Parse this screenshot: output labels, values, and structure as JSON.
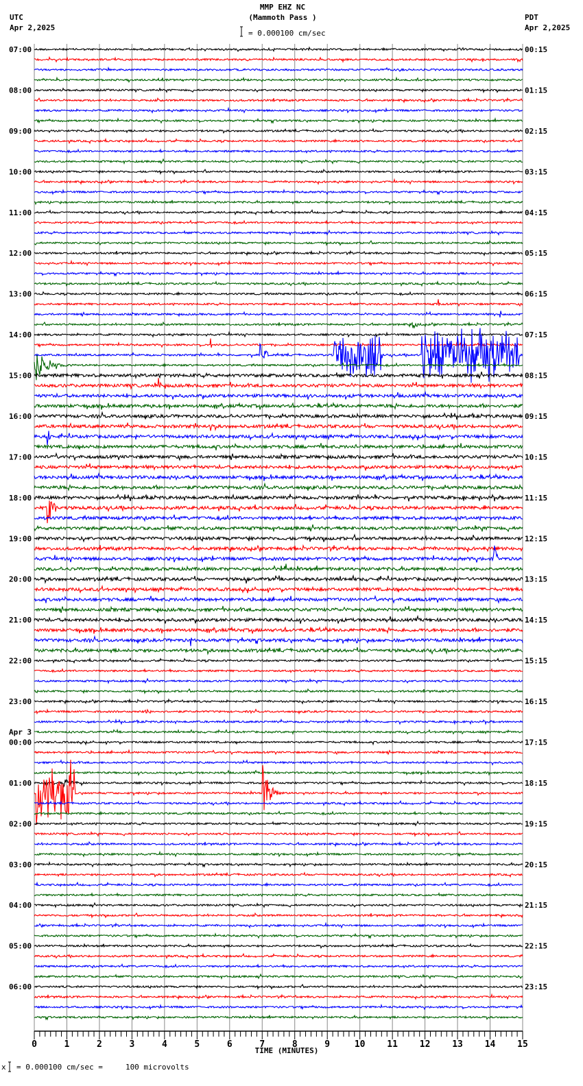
{
  "header": {
    "title": "MMP EHZ NC",
    "subtitle": "(Mammoth Pass )",
    "scale_text": "= 0.000100 cm/sec",
    "left_tz": "UTC",
    "left_date": "Apr 2,2025",
    "right_tz": "PDT",
    "right_date": "Apr 2,2025"
  },
  "footer": {
    "scale_prefix": "x",
    "scale_text": "= 0.000100 cm/sec =     100 microvolts"
  },
  "chart_data": {
    "type": "line",
    "title": "MMP EHZ NC (Mammoth Pass )",
    "xlabel": "TIME (MINUTES)",
    "xlim": [
      0,
      15
    ],
    "x_ticks": [
      "0",
      "1",
      "2",
      "3",
      "4",
      "5",
      "6",
      "7",
      "8",
      "9",
      "10",
      "11",
      "12",
      "13",
      "14",
      "15"
    ],
    "traces_per_hour": 4,
    "trace_count": 96,
    "trace_colors": [
      "#000000",
      "#ff0000",
      "#0000ff",
      "#006400"
    ],
    "grid": "vertical, every minute",
    "left_labels": [
      {
        "trace": 0,
        "text": "07:00"
      },
      {
        "trace": 4,
        "text": "08:00"
      },
      {
        "trace": 8,
        "text": "09:00"
      },
      {
        "trace": 12,
        "text": "10:00"
      },
      {
        "trace": 16,
        "text": "11:00"
      },
      {
        "trace": 20,
        "text": "12:00"
      },
      {
        "trace": 24,
        "text": "13:00"
      },
      {
        "trace": 28,
        "text": "14:00"
      },
      {
        "trace": 32,
        "text": "15:00"
      },
      {
        "trace": 36,
        "text": "16:00"
      },
      {
        "trace": 40,
        "text": "17:00"
      },
      {
        "trace": 44,
        "text": "18:00"
      },
      {
        "trace": 48,
        "text": "19:00"
      },
      {
        "trace": 52,
        "text": "20:00"
      },
      {
        "trace": 56,
        "text": "21:00"
      },
      {
        "trace": 60,
        "text": "22:00"
      },
      {
        "trace": 64,
        "text": "23:00"
      },
      {
        "trace": 68,
        "text": "00:00",
        "date": "Apr 3"
      },
      {
        "trace": 72,
        "text": "01:00"
      },
      {
        "trace": 76,
        "text": "02:00"
      },
      {
        "trace": 80,
        "text": "03:00"
      },
      {
        "trace": 84,
        "text": "04:00"
      },
      {
        "trace": 88,
        "text": "05:00"
      },
      {
        "trace": 92,
        "text": "06:00"
      }
    ],
    "right_labels": [
      "00:15",
      "01:15",
      "02:15",
      "03:15",
      "04:15",
      "05:15",
      "06:15",
      "07:15",
      "08:15",
      "09:15",
      "10:15",
      "11:15",
      "12:15",
      "13:15",
      "14:15",
      "15:15",
      "16:15",
      "17:15",
      "18:15",
      "19:15",
      "20:15",
      "21:15",
      "22:15",
      "23:15"
    ],
    "noisy_trace_range": [
      32,
      59
    ],
    "events": [
      {
        "trace": 25,
        "minute": 12.4,
        "amp": 0.6,
        "dur": 0.1
      },
      {
        "trace": 26,
        "minute": 14.3,
        "amp": 0.8,
        "dur": 0.1
      },
      {
        "trace": 27,
        "minute": 11.6,
        "amp": 0.8,
        "dur": 0.3
      },
      {
        "trace": 29,
        "minute": 5.4,
        "amp": 1.0,
        "dur": 0.1
      },
      {
        "trace": 30,
        "minute": 9.2,
        "amp": 2.5,
        "dur": 1.5
      },
      {
        "trace": 30,
        "minute": 11.9,
        "amp": 2.8,
        "dur": 3.0
      },
      {
        "trace": 30,
        "minute": 6.9,
        "amp": 2.0,
        "dur": 0.4
      },
      {
        "trace": 31,
        "minute": 0.0,
        "amp": 1.8,
        "dur": 1.0
      },
      {
        "trace": 33,
        "minute": 3.8,
        "amp": 1.8,
        "dur": 0.1
      },
      {
        "trace": 37,
        "minute": 5.4,
        "amp": 1.5,
        "dur": 0.1
      },
      {
        "trace": 38,
        "minute": 0.4,
        "amp": 2.0,
        "dur": 0.1
      },
      {
        "trace": 45,
        "minute": 0.4,
        "amp": 2.2,
        "dur": 0.4
      },
      {
        "trace": 50,
        "minute": 14.1,
        "amp": 2.5,
        "dur": 0.2
      },
      {
        "trace": 51,
        "minute": 7.7,
        "amp": 1.4,
        "dur": 0.1
      },
      {
        "trace": 52,
        "minute": 6.5,
        "amp": 1.0,
        "dur": 0.1
      },
      {
        "trace": 58,
        "minute": 4.8,
        "amp": 1.0,
        "dur": 0.1
      },
      {
        "trace": 65,
        "minute": 3.4,
        "amp": 1.2,
        "dur": 0.2
      },
      {
        "trace": 72,
        "minute": 0.9,
        "amp": 0.5,
        "dur": 0.6
      },
      {
        "trace": 73,
        "minute": 0.05,
        "amp": 3.5,
        "dur": 1.2
      },
      {
        "trace": 73,
        "minute": 7.0,
        "amp": 3.0,
        "dur": 0.6
      }
    ]
  }
}
